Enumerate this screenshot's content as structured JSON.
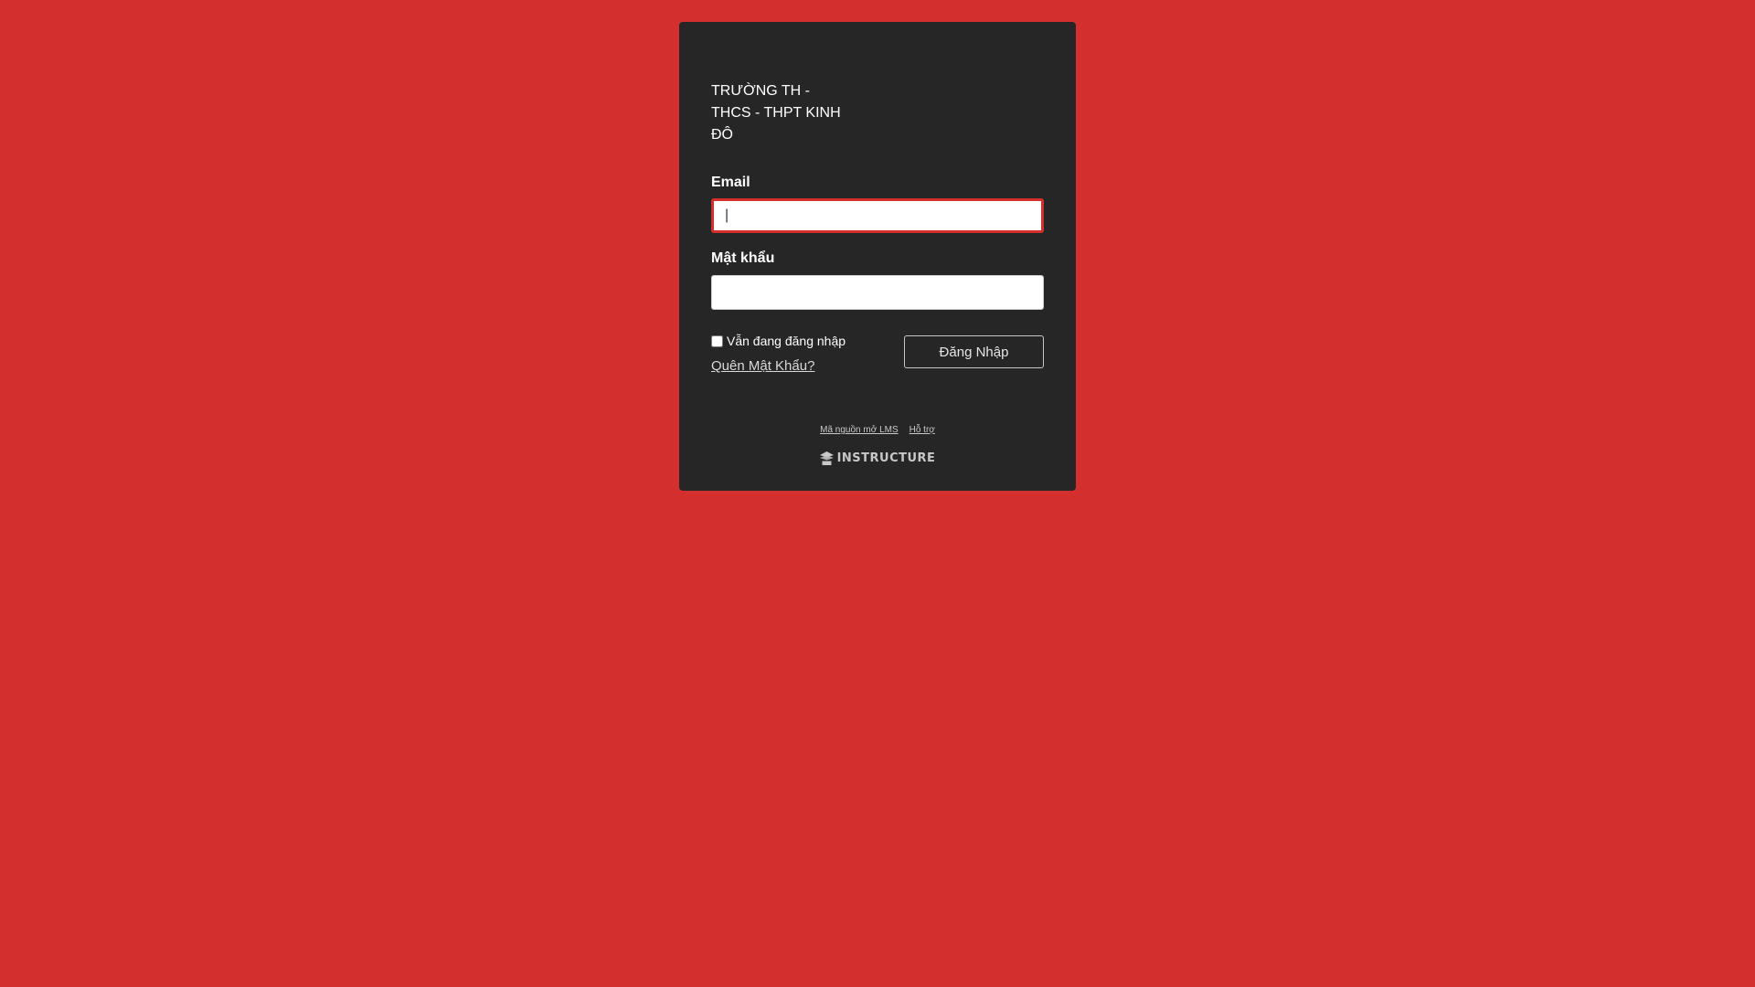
{
  "logo": {
    "alt_text": "TRƯỜNG TH - THCS - THPT KINH ĐÔ"
  },
  "form": {
    "email_label": "Email",
    "email_value": "|",
    "password_label": "Mật khẩu",
    "password_value": "",
    "remember_label": "Vẫn đang đăng nhập",
    "remember_checked": false,
    "forgot_link": "Quên Mật Khẩu?",
    "submit_label": "Đăng Nhập"
  },
  "footer": {
    "links": [
      "Mã nguồn mở LMS",
      "Hỗ trợ"
    ],
    "brand": "INSTRUCTURE",
    "brand_icon": "instructure-logo-icon"
  },
  "colors": {
    "background": "#d32f2f",
    "card": "#262626",
    "focus_border": "#d32f2f"
  }
}
